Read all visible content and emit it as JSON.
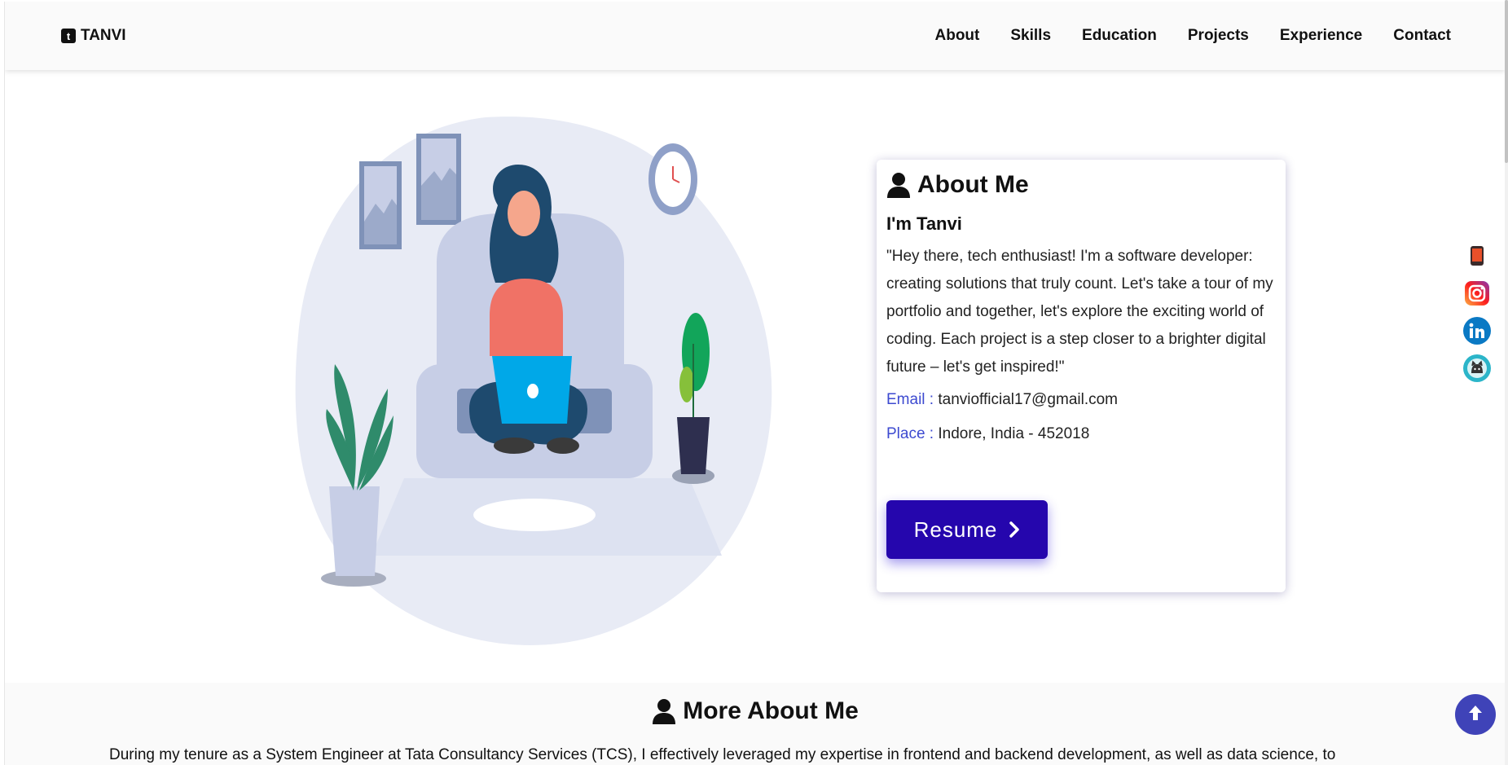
{
  "header": {
    "brand": "TANVI",
    "brand_icon": "t",
    "nav": [
      "About",
      "Skills",
      "Education",
      "Projects",
      "Experience",
      "Contact"
    ]
  },
  "about": {
    "title": "About Me",
    "name": "I'm Tanvi",
    "bio": "\"Hey there, tech enthusiast! I'm a software developer: creating solutions that truly count. Let's take a tour of my portfolio and together, let's explore the exciting world of coding. Each project is a step closer to a brighter digital future – let's get inspired!\"",
    "email_label": "Email :",
    "email": "tanviofficial17@gmail.com",
    "place_label": "Place :",
    "place": "Indore, India - 452018",
    "resume_label": "Resume"
  },
  "social": [
    "phone-icon",
    "instagram-icon",
    "linkedin-icon",
    "github-icon"
  ],
  "more": {
    "title": "More About Me",
    "text": "During my tenure as a System Engineer at Tata Consultancy Services (TCS), I effectively leveraged my expertise in frontend and backend development, as well as data science, to"
  },
  "colors": {
    "accent": "#2506ad",
    "label_blue": "#3d4ad0",
    "up_button": "#3f43b8"
  }
}
